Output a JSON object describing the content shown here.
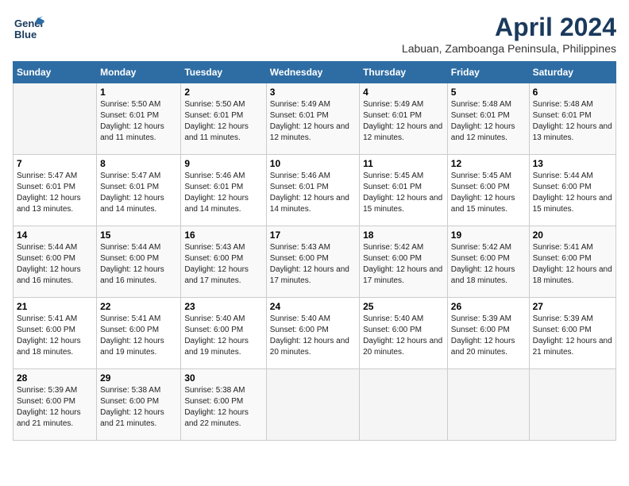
{
  "logo": {
    "line1": "General",
    "line2": "Blue"
  },
  "title": "April 2024",
  "subtitle": "Labuan, Zamboanga Peninsula, Philippines",
  "weekdays": [
    "Sunday",
    "Monday",
    "Tuesday",
    "Wednesday",
    "Thursday",
    "Friday",
    "Saturday"
  ],
  "weeks": [
    [
      {
        "day": "",
        "sunrise": "",
        "sunset": "",
        "daylight": ""
      },
      {
        "day": "1",
        "sunrise": "Sunrise: 5:50 AM",
        "sunset": "Sunset: 6:01 PM",
        "daylight": "Daylight: 12 hours and 11 minutes."
      },
      {
        "day": "2",
        "sunrise": "Sunrise: 5:50 AM",
        "sunset": "Sunset: 6:01 PM",
        "daylight": "Daylight: 12 hours and 11 minutes."
      },
      {
        "day": "3",
        "sunrise": "Sunrise: 5:49 AM",
        "sunset": "Sunset: 6:01 PM",
        "daylight": "Daylight: 12 hours and 12 minutes."
      },
      {
        "day": "4",
        "sunrise": "Sunrise: 5:49 AM",
        "sunset": "Sunset: 6:01 PM",
        "daylight": "Daylight: 12 hours and 12 minutes."
      },
      {
        "day": "5",
        "sunrise": "Sunrise: 5:48 AM",
        "sunset": "Sunset: 6:01 PM",
        "daylight": "Daylight: 12 hours and 12 minutes."
      },
      {
        "day": "6",
        "sunrise": "Sunrise: 5:48 AM",
        "sunset": "Sunset: 6:01 PM",
        "daylight": "Daylight: 12 hours and 13 minutes."
      }
    ],
    [
      {
        "day": "7",
        "sunrise": "Sunrise: 5:47 AM",
        "sunset": "Sunset: 6:01 PM",
        "daylight": "Daylight: 12 hours and 13 minutes."
      },
      {
        "day": "8",
        "sunrise": "Sunrise: 5:47 AM",
        "sunset": "Sunset: 6:01 PM",
        "daylight": "Daylight: 12 hours and 14 minutes."
      },
      {
        "day": "9",
        "sunrise": "Sunrise: 5:46 AM",
        "sunset": "Sunset: 6:01 PM",
        "daylight": "Daylight: 12 hours and 14 minutes."
      },
      {
        "day": "10",
        "sunrise": "Sunrise: 5:46 AM",
        "sunset": "Sunset: 6:01 PM",
        "daylight": "Daylight: 12 hours and 14 minutes."
      },
      {
        "day": "11",
        "sunrise": "Sunrise: 5:45 AM",
        "sunset": "Sunset: 6:01 PM",
        "daylight": "Daylight: 12 hours and 15 minutes."
      },
      {
        "day": "12",
        "sunrise": "Sunrise: 5:45 AM",
        "sunset": "Sunset: 6:00 PM",
        "daylight": "Daylight: 12 hours and 15 minutes."
      },
      {
        "day": "13",
        "sunrise": "Sunrise: 5:44 AM",
        "sunset": "Sunset: 6:00 PM",
        "daylight": "Daylight: 12 hours and 15 minutes."
      }
    ],
    [
      {
        "day": "14",
        "sunrise": "Sunrise: 5:44 AM",
        "sunset": "Sunset: 6:00 PM",
        "daylight": "Daylight: 12 hours and 16 minutes."
      },
      {
        "day": "15",
        "sunrise": "Sunrise: 5:44 AM",
        "sunset": "Sunset: 6:00 PM",
        "daylight": "Daylight: 12 hours and 16 minutes."
      },
      {
        "day": "16",
        "sunrise": "Sunrise: 5:43 AM",
        "sunset": "Sunset: 6:00 PM",
        "daylight": "Daylight: 12 hours and 17 minutes."
      },
      {
        "day": "17",
        "sunrise": "Sunrise: 5:43 AM",
        "sunset": "Sunset: 6:00 PM",
        "daylight": "Daylight: 12 hours and 17 minutes."
      },
      {
        "day": "18",
        "sunrise": "Sunrise: 5:42 AM",
        "sunset": "Sunset: 6:00 PM",
        "daylight": "Daylight: 12 hours and 17 minutes."
      },
      {
        "day": "19",
        "sunrise": "Sunrise: 5:42 AM",
        "sunset": "Sunset: 6:00 PM",
        "daylight": "Daylight: 12 hours and 18 minutes."
      },
      {
        "day": "20",
        "sunrise": "Sunrise: 5:41 AM",
        "sunset": "Sunset: 6:00 PM",
        "daylight": "Daylight: 12 hours and 18 minutes."
      }
    ],
    [
      {
        "day": "21",
        "sunrise": "Sunrise: 5:41 AM",
        "sunset": "Sunset: 6:00 PM",
        "daylight": "Daylight: 12 hours and 18 minutes."
      },
      {
        "day": "22",
        "sunrise": "Sunrise: 5:41 AM",
        "sunset": "Sunset: 6:00 PM",
        "daylight": "Daylight: 12 hours and 19 minutes."
      },
      {
        "day": "23",
        "sunrise": "Sunrise: 5:40 AM",
        "sunset": "Sunset: 6:00 PM",
        "daylight": "Daylight: 12 hours and 19 minutes."
      },
      {
        "day": "24",
        "sunrise": "Sunrise: 5:40 AM",
        "sunset": "Sunset: 6:00 PM",
        "daylight": "Daylight: 12 hours and 20 minutes."
      },
      {
        "day": "25",
        "sunrise": "Sunrise: 5:40 AM",
        "sunset": "Sunset: 6:00 PM",
        "daylight": "Daylight: 12 hours and 20 minutes."
      },
      {
        "day": "26",
        "sunrise": "Sunrise: 5:39 AM",
        "sunset": "Sunset: 6:00 PM",
        "daylight": "Daylight: 12 hours and 20 minutes."
      },
      {
        "day": "27",
        "sunrise": "Sunrise: 5:39 AM",
        "sunset": "Sunset: 6:00 PM",
        "daylight": "Daylight: 12 hours and 21 minutes."
      }
    ],
    [
      {
        "day": "28",
        "sunrise": "Sunrise: 5:39 AM",
        "sunset": "Sunset: 6:00 PM",
        "daylight": "Daylight: 12 hours and 21 minutes."
      },
      {
        "day": "29",
        "sunrise": "Sunrise: 5:38 AM",
        "sunset": "Sunset: 6:00 PM",
        "daylight": "Daylight: 12 hours and 21 minutes."
      },
      {
        "day": "30",
        "sunrise": "Sunrise: 5:38 AM",
        "sunset": "Sunset: 6:00 PM",
        "daylight": "Daylight: 12 hours and 22 minutes."
      },
      {
        "day": "",
        "sunrise": "",
        "sunset": "",
        "daylight": ""
      },
      {
        "day": "",
        "sunrise": "",
        "sunset": "",
        "daylight": ""
      },
      {
        "day": "",
        "sunrise": "",
        "sunset": "",
        "daylight": ""
      },
      {
        "day": "",
        "sunrise": "",
        "sunset": "",
        "daylight": ""
      }
    ]
  ]
}
